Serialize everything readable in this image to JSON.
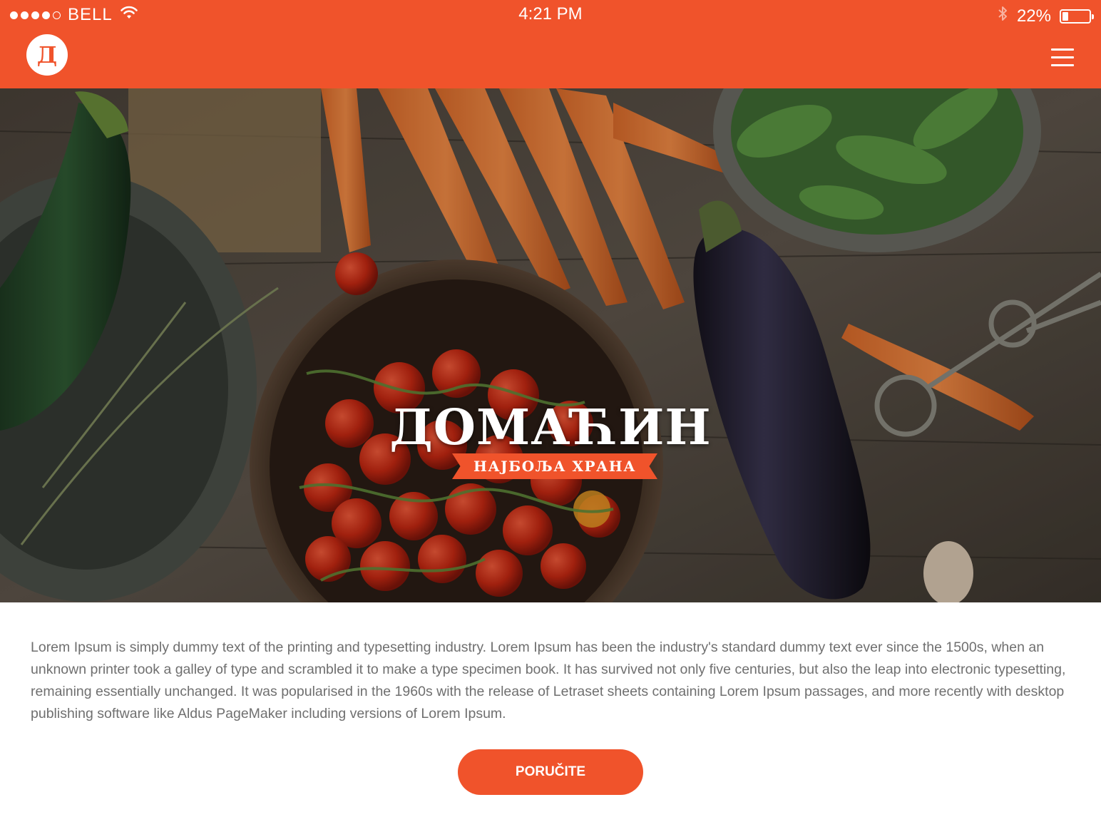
{
  "status_bar": {
    "carrier": "BELL",
    "time": "4:21 PM",
    "battery_percent": "22%",
    "battery_level": 0.22,
    "signal_bars_filled": 4,
    "signal_bars_total": 5,
    "icons": [
      "wifi-icon",
      "bluetooth-icon",
      "battery-icon"
    ]
  },
  "navbar": {
    "logo_letter": "Д",
    "menu_icon": "hamburger-menu-icon"
  },
  "hero": {
    "title": "ДОМАЋИН",
    "subtitle": "НАЈБОЉА ХРАНА"
  },
  "content": {
    "body": "Lorem Ipsum is simply dummy text of the printing and typesetting industry. Lorem Ipsum has been the industry's standard dummy text ever since the 1500s, when an unknown printer took a galley of type and scrambled it to make a type specimen book. It has survived not only five centuries, but also the leap into electronic typesetting, remaining essentially unchanged. It was popularised in the 1960s with the release of Letraset sheets containing Lorem Ipsum passages, and more recently with desktop publishing software like Aldus PageMaker including versions of Lorem Ipsum.",
    "cta_label": "PORUČITE"
  },
  "colors": {
    "accent": "#f0532b",
    "text": "#6f6f6f",
    "background": "#ffffff"
  }
}
